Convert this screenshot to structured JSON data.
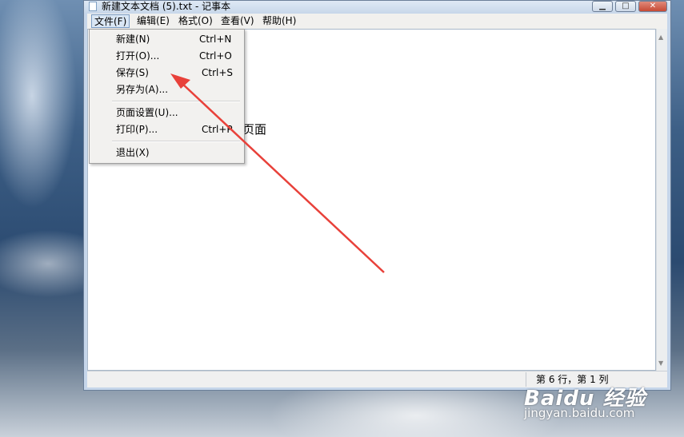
{
  "window": {
    "title": "新建文本文档 (5).txt - 记事本",
    "controls": {
      "minimize": "▁",
      "maximize": "□",
      "close": "✕"
    }
  },
  "menubar": {
    "items": [
      {
        "label": "文件(F)"
      },
      {
        "label": "编辑(E)"
      },
      {
        "label": "格式(O)"
      },
      {
        "label": "查看(V)"
      },
      {
        "label": "帮助(H)"
      }
    ]
  },
  "file_menu": {
    "items": [
      {
        "label": "新建(N)",
        "shortcut": "Ctrl+N"
      },
      {
        "label": "打开(O)...",
        "shortcut": "Ctrl+O"
      },
      {
        "label": "保存(S)",
        "shortcut": "Ctrl+S"
      },
      {
        "label": "另存为(A)...",
        "shortcut": ""
      },
      {
        "label": "页面设置(U)...",
        "shortcut": ""
      },
      {
        "label": "打印(P)...",
        "shortcut": "Ctrl+P"
      },
      {
        "label": "退出(X)",
        "shortcut": ""
      }
    ]
  },
  "editor": {
    "visible_text": "页面"
  },
  "statusbar": {
    "position": "第 6 行，第 1 列"
  },
  "scrollbar": {
    "up": "▲",
    "down": "▼"
  },
  "annotation": {
    "arrow_color": "#e8413a"
  },
  "watermark": {
    "logo": "Baidu 经验",
    "url": "jingyan.baidu.com"
  }
}
